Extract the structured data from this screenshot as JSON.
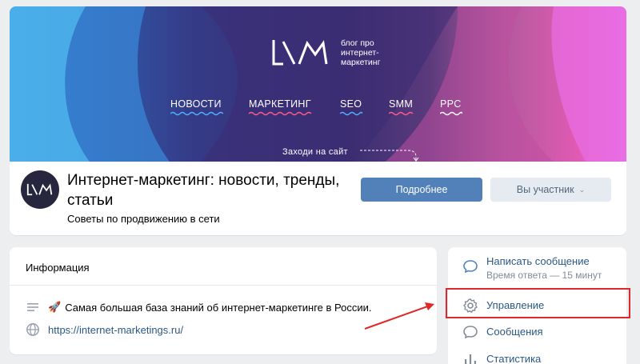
{
  "cover": {
    "logo_text": "блог про\nинтернет-\nмаркетинг",
    "nav": [
      "НОВОСТИ",
      "МАРКЕТИНГ",
      "SEO",
      "SMM",
      "PPC"
    ],
    "cta": "Заходи на сайт"
  },
  "header": {
    "title": "Интернет-маркетинг: новости, тренды, статьи",
    "status": "Советы по продвижению в сети",
    "primary_button": "Подробнее",
    "secondary_button": "Вы участник",
    "secondary_chevron": "⌄"
  },
  "info": {
    "title": "Информация",
    "description_emoji": "🚀",
    "description": "Самая большая база знаний об интернет-маркетинге в России.",
    "link": "https://internet-marketings.ru/"
  },
  "side_menu": {
    "items": [
      {
        "label": "Написать сообщение",
        "sub": "Время ответа — 15 минут",
        "icon": "message-bubble-icon"
      },
      {
        "label": "Управление",
        "icon": "gear-icon"
      },
      {
        "label": "Сообщения",
        "icon": "message-bubble-icon"
      },
      {
        "label": "Статистика",
        "icon": "bar-chart-icon"
      }
    ]
  },
  "colors": {
    "accent": "#5181b8",
    "link": "#2a5885",
    "highlight": "#e0272a",
    "nav_wave": [
      "#4fb2ff",
      "#ff5a8a",
      "#4fb2ff",
      "#ff5a8a",
      "#ffffff"
    ]
  }
}
